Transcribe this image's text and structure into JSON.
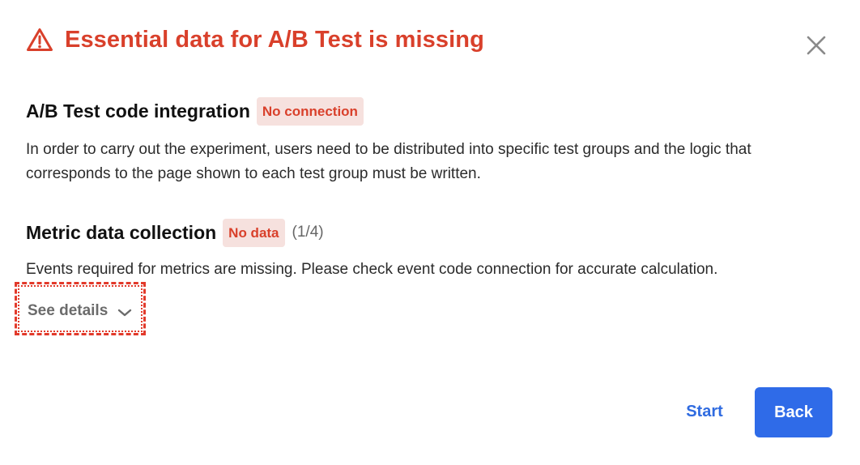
{
  "dialog": {
    "title": "Essential data for A/B Test is missing",
    "title_icon": "warning-triangle-icon",
    "close_icon": "close-icon",
    "accent_color": "#d9402b"
  },
  "sections": [
    {
      "title": "A/B Test code integration",
      "badge": "No connection",
      "count": "",
      "description": "In order to carry out the experiment, users need to be distributed into specific test groups and the logic that corresponds to the page shown to each test group must be written."
    },
    {
      "title": "Metric data collection",
      "badge": "No data",
      "count": "(1/4)",
      "description": "Events required for metrics are missing. Please check event code connection for accurate calculation."
    }
  ],
  "details": {
    "label": "See details",
    "icon": "chevron-down-icon"
  },
  "footer": {
    "start_label": "Start",
    "back_label": "Back",
    "primary_color": "#2f6be8"
  }
}
